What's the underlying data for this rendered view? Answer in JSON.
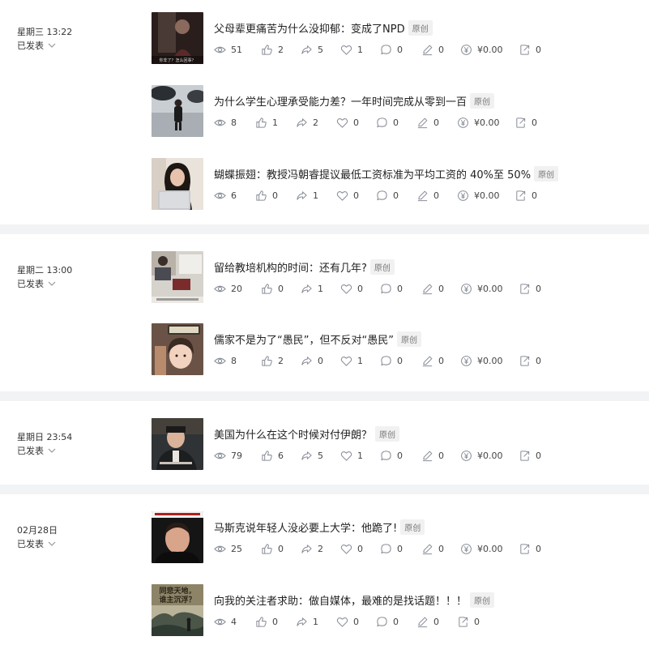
{
  "groups": [
    {
      "date": "星期三 13:22",
      "status": "已发表",
      "articles": [
        {
          "title": "父母辈更痛苦为什么没抑郁：变成了NPD",
          "badge": "原创",
          "thumb_caption": "你非了？怎么回事？",
          "stats": {
            "views": "51",
            "likes": "2",
            "shares": "5",
            "favs": "1",
            "comments": "0",
            "edits": "0",
            "money": "¥0.00",
            "forwards": "0"
          }
        },
        {
          "title": "为什么学生心理承受能力差？一年时间完成从零到一百",
          "badge": "原创",
          "thumb_caption": "",
          "stats": {
            "views": "8",
            "likes": "1",
            "shares": "2",
            "favs": "0",
            "comments": "0",
            "edits": "0",
            "money": "¥0.00",
            "forwards": "0"
          }
        },
        {
          "title": "蝴蝶振翅：教授冯朝睿提议最低工资标准为平均工资的 40%至 50%",
          "badge": "原创",
          "thumb_caption": "",
          "stats": {
            "views": "6",
            "likes": "0",
            "shares": "1",
            "favs": "0",
            "comments": "0",
            "edits": "0",
            "money": "¥0.00",
            "forwards": "0"
          }
        }
      ]
    },
    {
      "date": "星期二 13:00",
      "status": "已发表",
      "articles": [
        {
          "title": "留给教培机构的时间：还有几年?",
          "badge": "原创",
          "thumb_caption": "",
          "stats": {
            "views": "20",
            "likes": "0",
            "shares": "1",
            "favs": "0",
            "comments": "0",
            "edits": "0",
            "money": "¥0.00",
            "forwards": "0"
          }
        },
        {
          "title": "儒家不是为了“愚民”，但不反对“愚民”",
          "badge": "原创",
          "thumb_caption": "",
          "stats": {
            "views": "8",
            "likes": "2",
            "shares": "0",
            "favs": "1",
            "comments": "0",
            "edits": "0",
            "money": "¥0.00",
            "forwards": "0"
          }
        }
      ]
    },
    {
      "date": "星期日 23:54",
      "status": "已发表",
      "articles": [
        {
          "title": "美国为什么在这个时候对付伊朗？",
          "badge": "原创",
          "thumb_caption": "",
          "stats": {
            "views": "79",
            "likes": "6",
            "shares": "5",
            "favs": "1",
            "comments": "0",
            "edits": "0",
            "money": "¥0.00",
            "forwards": "0"
          }
        }
      ]
    },
    {
      "date": "02月28日",
      "status": "已发表",
      "articles": [
        {
          "title": "马斯克说年轻人没必要上大学：他跪了!",
          "badge": "原创",
          "thumb_caption": "",
          "stats": {
            "views": "25",
            "likes": "0",
            "shares": "2",
            "favs": "0",
            "comments": "0",
            "edits": "0",
            "money": "¥0.00",
            "forwards": "0"
          }
        },
        {
          "title": "向我的关注者求助：做自媒体，最难的是找话题！！！",
          "badge": "原创",
          "thumb_caption": "同悲天地，\n谁主沉浮？",
          "stats": {
            "views": "4",
            "likes": "0",
            "shares": "1",
            "favs": "0",
            "comments": "0",
            "edits": "0",
            "forwards": "0"
          }
        }
      ]
    }
  ],
  "icons": [
    "eye-icon",
    "thumbs-up-icon",
    "share-arrow-icon",
    "heart-icon",
    "comment-icon",
    "pen-icon",
    "yuan-icon",
    "forward-icon",
    "chevron-down-icon"
  ]
}
